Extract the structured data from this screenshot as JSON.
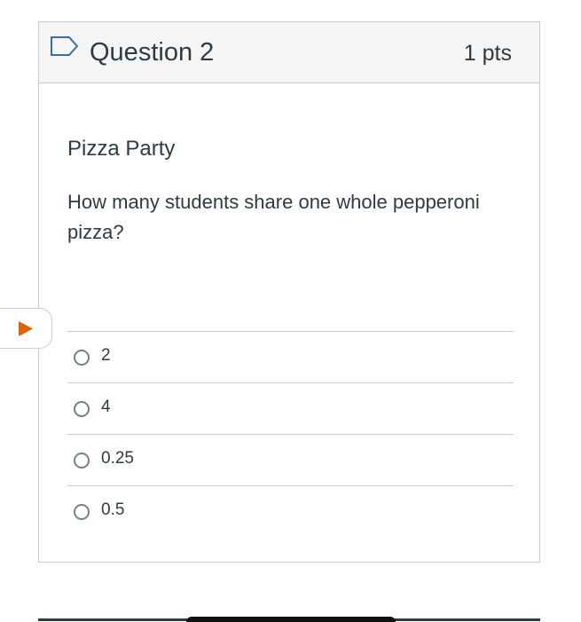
{
  "question": {
    "title": "Question 2",
    "points": "1 pts",
    "heading": "Pizza Party",
    "text": "How many students share one whole pepperoni pizza?",
    "flag_icon": "bookmark-flag-icon"
  },
  "answers": [
    {
      "label": "2",
      "selected": false
    },
    {
      "label": "4",
      "selected": false
    },
    {
      "label": "0.25",
      "selected": false
    },
    {
      "label": "0.5",
      "selected": false
    }
  ],
  "side_tab": {
    "icon": "play-icon",
    "accent": "#e66000"
  },
  "colors": {
    "text": "#2d3b45",
    "border": "#c7cdd1",
    "header_bg": "#f5f5f5"
  }
}
